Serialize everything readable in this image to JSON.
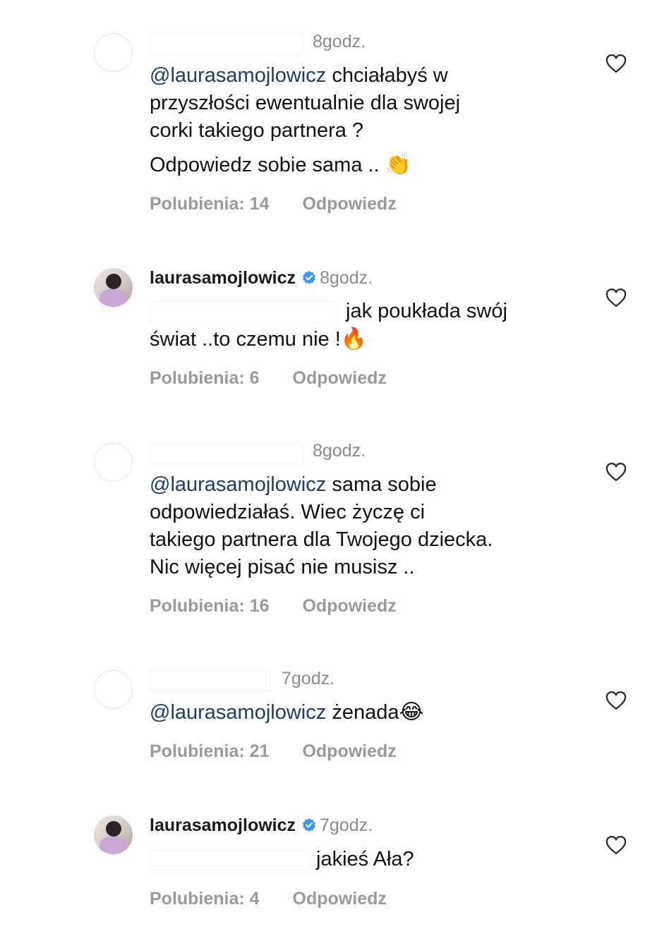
{
  "comments": [
    {
      "username": "",
      "verified": false,
      "time": "8godz.",
      "mention": "@laurasamojlowicz",
      "text_lines": [
        "chciałabyś w",
        "przyszłości ewentualnie dla swojej",
        "corki takiego partnera ?"
      ],
      "extra_line": "Odpowiedz sobie sama ..",
      "emoji": "👏",
      "likes": "Polubienia: 14",
      "reply": "Odpowiedz"
    },
    {
      "username": "laurasamojlowicz",
      "verified": true,
      "time": "8godz.",
      "text_lines": [
        "jak poukłada swój",
        "świat ..to czemu nie !"
      ],
      "emoji": "🔥",
      "likes": "Polubienia: 6",
      "reply": "Odpowiedz"
    },
    {
      "username": "",
      "verified": false,
      "time": "8godz.",
      "mention": "@laurasamojlowicz",
      "text_lines": [
        "sama sobie",
        "odpowiedziałaś. Wiec życzę ci",
        "takiego partnera dla Twojego dziecka.",
        "Nic więcej pisać nie musisz .."
      ],
      "likes": "Polubienia: 16",
      "reply": "Odpowiedz"
    },
    {
      "username": "",
      "verified": false,
      "time": "7godz.",
      "mention": "@laurasamojlowicz",
      "text_lines": [
        "żenada"
      ],
      "emoji": "😂",
      "likes": "Polubienia: 21",
      "reply": "Odpowiedz"
    },
    {
      "username": "laurasamojlowicz",
      "verified": true,
      "time": "7godz.",
      "text_lines": [
        "jakieś Ała?"
      ],
      "likes": "Polubienia: 4",
      "reply": "Odpowiedz"
    }
  ],
  "icons": {
    "heart": "heart-outline-icon",
    "verified": "verified-badge-icon",
    "verified_color": "#3897f0"
  }
}
